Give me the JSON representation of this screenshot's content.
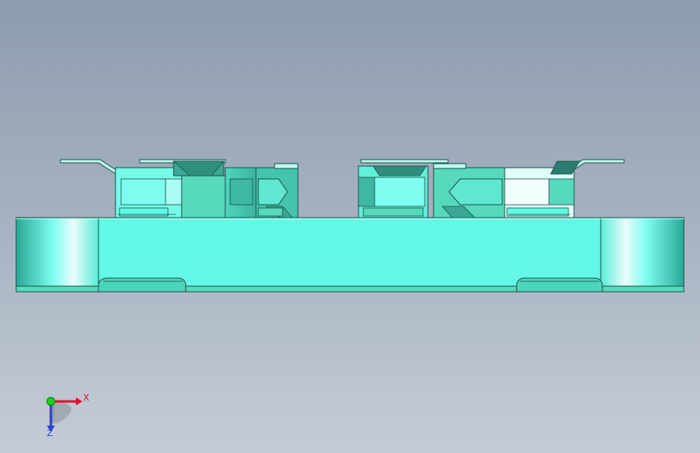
{
  "viewport": {
    "background_top": "#8d9cae",
    "background_bottom": "#c4ccd6"
  },
  "model": {
    "body_color": "#63f8e6",
    "shade_dark": "#3aa895",
    "shade_mid": "#56d9bd",
    "outline_color": "#1d5148",
    "highlight_color": "#e9fdfb"
  },
  "triad": {
    "x_label": "X",
    "z_label": "Z",
    "x_color": "#e0102a",
    "y_color": "#1bd11b",
    "z_color": "#2c3fd1",
    "icons": [
      "x-axis-arrow-icon",
      "y-axis-origin-icon",
      "z-axis-arrow-icon"
    ]
  }
}
